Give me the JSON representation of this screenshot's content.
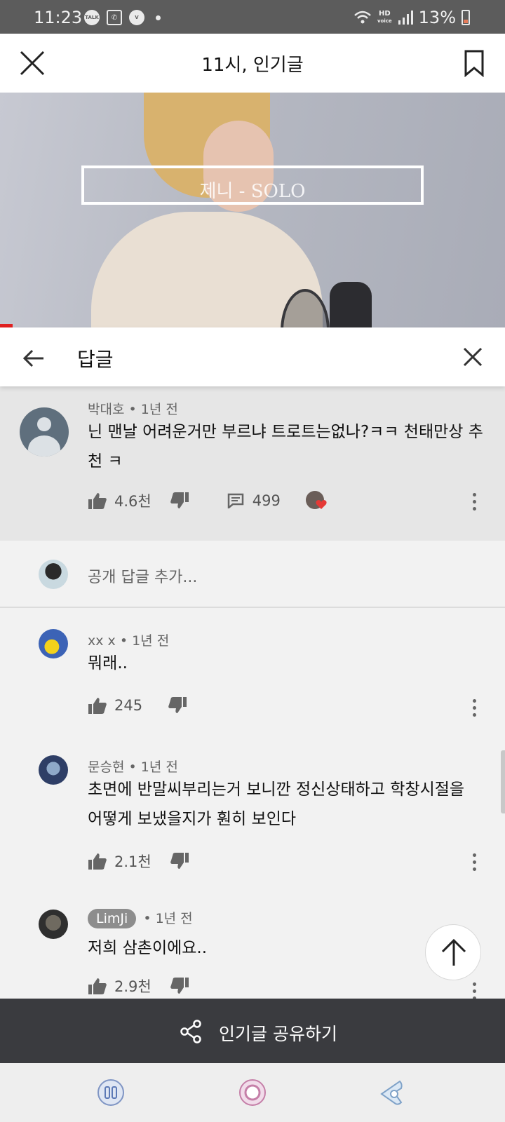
{
  "status_bar": {
    "time": "11:23",
    "notification_icons": [
      "talk-icon",
      "missed-call-icon",
      "vpn-icon"
    ],
    "network": "HD",
    "network_sub": "voice",
    "battery_percent": "13%"
  },
  "header": {
    "title": "11시, 인기글"
  },
  "video": {
    "overlay_text": "제니 - SOLO",
    "progress_fraction": 0.025
  },
  "replies_panel": {
    "title": "답글"
  },
  "main_comment": {
    "author": "박대호",
    "time": "1년 전",
    "separator": "•",
    "text": "닌 맨날 어려운거만 부르냐 트로트는없나?ㅋㅋ 천태만상 추천 ㅋ",
    "likes": "4.6천",
    "reply_count": "499"
  },
  "add_reply": {
    "placeholder": "공개 답글 추가..."
  },
  "replies": [
    {
      "author": "xx x",
      "time": "1년 전",
      "text": "뭐래..",
      "likes": "245"
    },
    {
      "author": "문승현",
      "time": "1년 전",
      "text": "초면에 반말씨부리는거 보니깐 정신상태하고 학창시절을 어떻게 보냈을지가 훤히 보인다",
      "likes": "2.1천"
    },
    {
      "author": "LimJi",
      "time": "1년 전",
      "text": "저희 삼촌이에요..",
      "likes": "2.9천"
    }
  ],
  "share_bar": {
    "label": "인기글 공유하기"
  },
  "colors": {
    "status_bar": "#5c5c5c",
    "share_bar": "#3a3b3f",
    "progress": "#e02020",
    "heart": "#e53935"
  }
}
